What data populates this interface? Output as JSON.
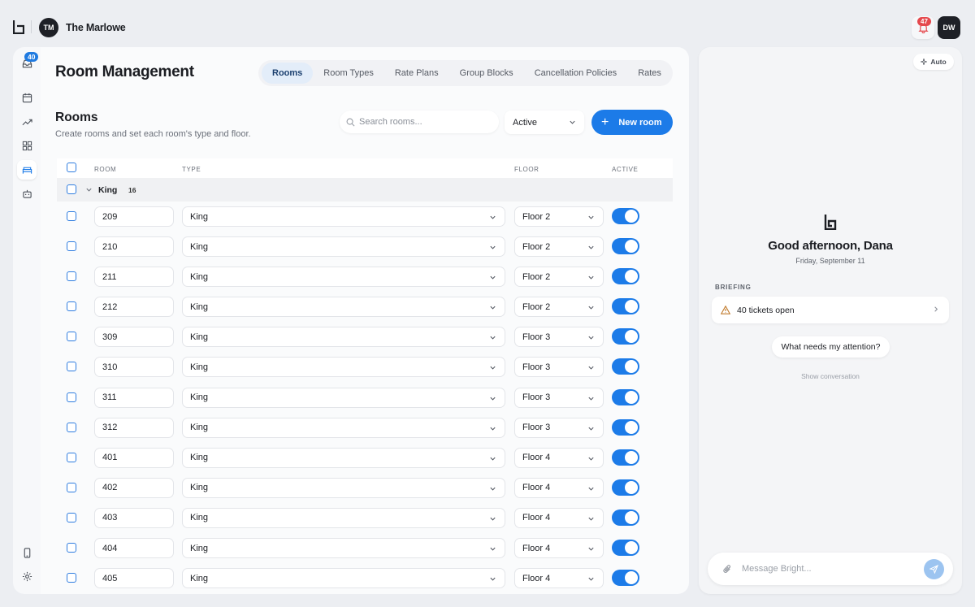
{
  "topbar": {
    "hotel_initials": "TM",
    "hotel_name": "The Marlowe",
    "notification_count": "47",
    "user_initials": "DW"
  },
  "rail": {
    "inbox_badge": "40",
    "items": [
      "inbox-icon",
      "calendar-icon",
      "trending-icon",
      "grid-icon",
      "bed-icon",
      "bot-icon",
      "phone-icon",
      "settings-icon"
    ]
  },
  "main": {
    "page_title": "Room Management",
    "tabs": [
      {
        "label": "Rooms",
        "active": true
      },
      {
        "label": "Room Types"
      },
      {
        "label": "Rate Plans"
      },
      {
        "label": "Group Blocks"
      },
      {
        "label": "Cancellation Policies"
      },
      {
        "label": "Rates"
      }
    ],
    "section_title": "Rooms",
    "section_subtitle": "Create rooms and set each room's type and floor.",
    "search_placeholder": "Search rooms...",
    "filter_value": "Active",
    "new_button": "New room"
  },
  "table": {
    "columns": {
      "room": "ROOM",
      "type": "TYPE",
      "floor": "FLOOR",
      "active": "ACTIVE"
    },
    "group": {
      "name": "King",
      "count": "16"
    },
    "rows": [
      {
        "room": "209",
        "type": "King",
        "floor": "Floor 2",
        "active": true
      },
      {
        "room": "210",
        "type": "King",
        "floor": "Floor 2",
        "active": true
      },
      {
        "room": "211",
        "type": "King",
        "floor": "Floor 2",
        "active": true
      },
      {
        "room": "212",
        "type": "King",
        "floor": "Floor 2",
        "active": true
      },
      {
        "room": "309",
        "type": "King",
        "floor": "Floor 3",
        "active": true
      },
      {
        "room": "310",
        "type": "King",
        "floor": "Floor 3",
        "active": true
      },
      {
        "room": "311",
        "type": "King",
        "floor": "Floor 3",
        "active": true
      },
      {
        "room": "312",
        "type": "King",
        "floor": "Floor 3",
        "active": true
      },
      {
        "room": "401",
        "type": "King",
        "floor": "Floor 4",
        "active": true
      },
      {
        "room": "402",
        "type": "King",
        "floor": "Floor 4",
        "active": true
      },
      {
        "room": "403",
        "type": "King",
        "floor": "Floor 4",
        "active": true
      },
      {
        "room": "404",
        "type": "King",
        "floor": "Floor 4",
        "active": true
      },
      {
        "room": "405",
        "type": "King",
        "floor": "Floor 4",
        "active": true
      }
    ]
  },
  "assistant": {
    "mode_label": "Auto",
    "greeting": "Good afternoon, Dana",
    "date": "Friday, September 11",
    "briefing_label": "BRIEFING",
    "briefing_item": "40 tickets open",
    "suggestion": "What needs my attention?",
    "show_conversation": "Show conversation",
    "message_placeholder": "Message Bright..."
  },
  "colors": {
    "accent": "#1c7be8",
    "notification": "#e5484d"
  }
}
